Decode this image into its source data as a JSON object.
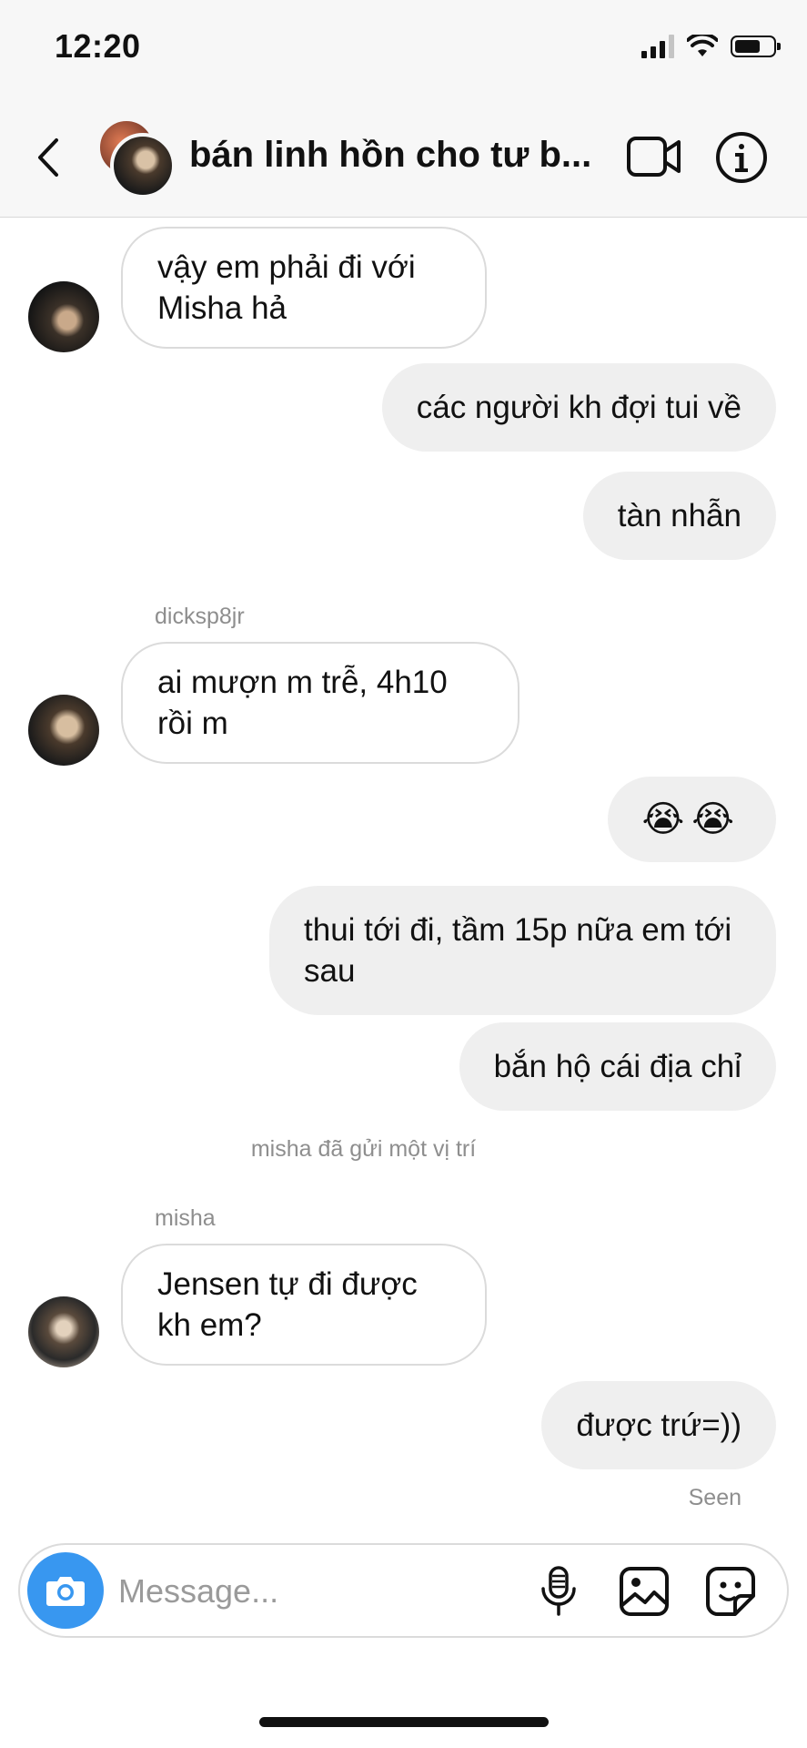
{
  "status_bar": {
    "time": "12:20",
    "signal_bars_filled": 3,
    "signal_bars_total": 4,
    "battery_level": 0.7
  },
  "header": {
    "title": "bán linh hồn cho tư b...",
    "back_icon": "chevron-left-icon",
    "video_icon": "video-camera-icon",
    "info_icon": "info-icon"
  },
  "messages": [
    {
      "direction": "incoming",
      "text": "vậy em phải đi với Misha hả"
    },
    {
      "direction": "outgoing",
      "text": "các người kh đợi tui về"
    },
    {
      "direction": "outgoing",
      "text": "tàn nhẫn"
    },
    {
      "direction": "incoming",
      "sender": "dicksp8jr",
      "text": "ai mượn m trễ, 4h10 rồi m"
    },
    {
      "direction": "outgoing",
      "text": "😭😭"
    },
    {
      "direction": "outgoing",
      "text": "thui tới đi, tầm 15p nữa em tới sau"
    },
    {
      "direction": "outgoing",
      "text": "bắn hộ cái địa chỉ"
    },
    {
      "system": "misha đã gửi một vị trí"
    },
    {
      "direction": "incoming",
      "sender": "misha",
      "text": "Jensen tự đi được kh em?"
    },
    {
      "direction": "outgoing",
      "text": "được trứ=))"
    }
  ],
  "seen_label": "Seen",
  "composer": {
    "placeholder": "Message...",
    "camera_icon": "camera-icon",
    "mic_icon": "microphone-icon",
    "gallery_icon": "image-gallery-icon",
    "sticker_icon": "sticker-icon"
  },
  "colors": {
    "accent": "#3897f0",
    "outgoing_bubble": "#efefef",
    "incoming_border": "#dbdbdb",
    "meta_text": "#8e8e8e"
  }
}
